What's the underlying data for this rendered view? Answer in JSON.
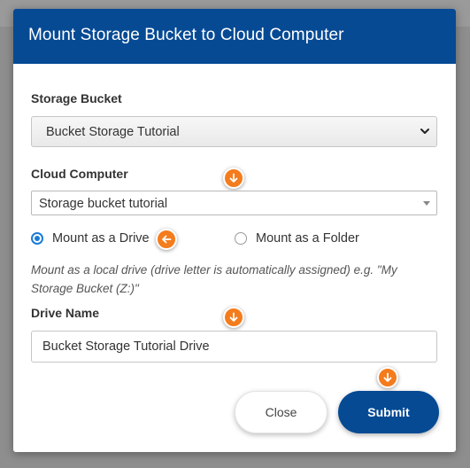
{
  "dialog": {
    "title": "Mount Storage Bucket to Cloud Computer"
  },
  "storage_bucket": {
    "label": "Storage Bucket",
    "selected": "Bucket Storage Tutorial"
  },
  "cloud_computer": {
    "label": "Cloud Computer",
    "selected": "Storage bucket tutorial"
  },
  "mount_options": [
    {
      "label": "Mount as a Drive",
      "checked": true
    },
    {
      "label": "Mount as a Folder",
      "checked": false
    }
  ],
  "help_text": "Mount as a local drive (drive letter is automatically assigned) e.g. \"My Storage Bucket (Z:)\"",
  "drive_name": {
    "label": "Drive Name",
    "value": "Bucket Storage Tutorial Drive"
  },
  "actions": {
    "close_label": "Close",
    "submit_label": "Submit"
  },
  "hints": {
    "color": "#f47c1c",
    "icons": [
      "arrow-down-icon",
      "arrow-left-icon"
    ]
  },
  "colors": {
    "header": "#064a94",
    "primary_button": "#064a94",
    "radio_accent": "#1b7bd8"
  }
}
